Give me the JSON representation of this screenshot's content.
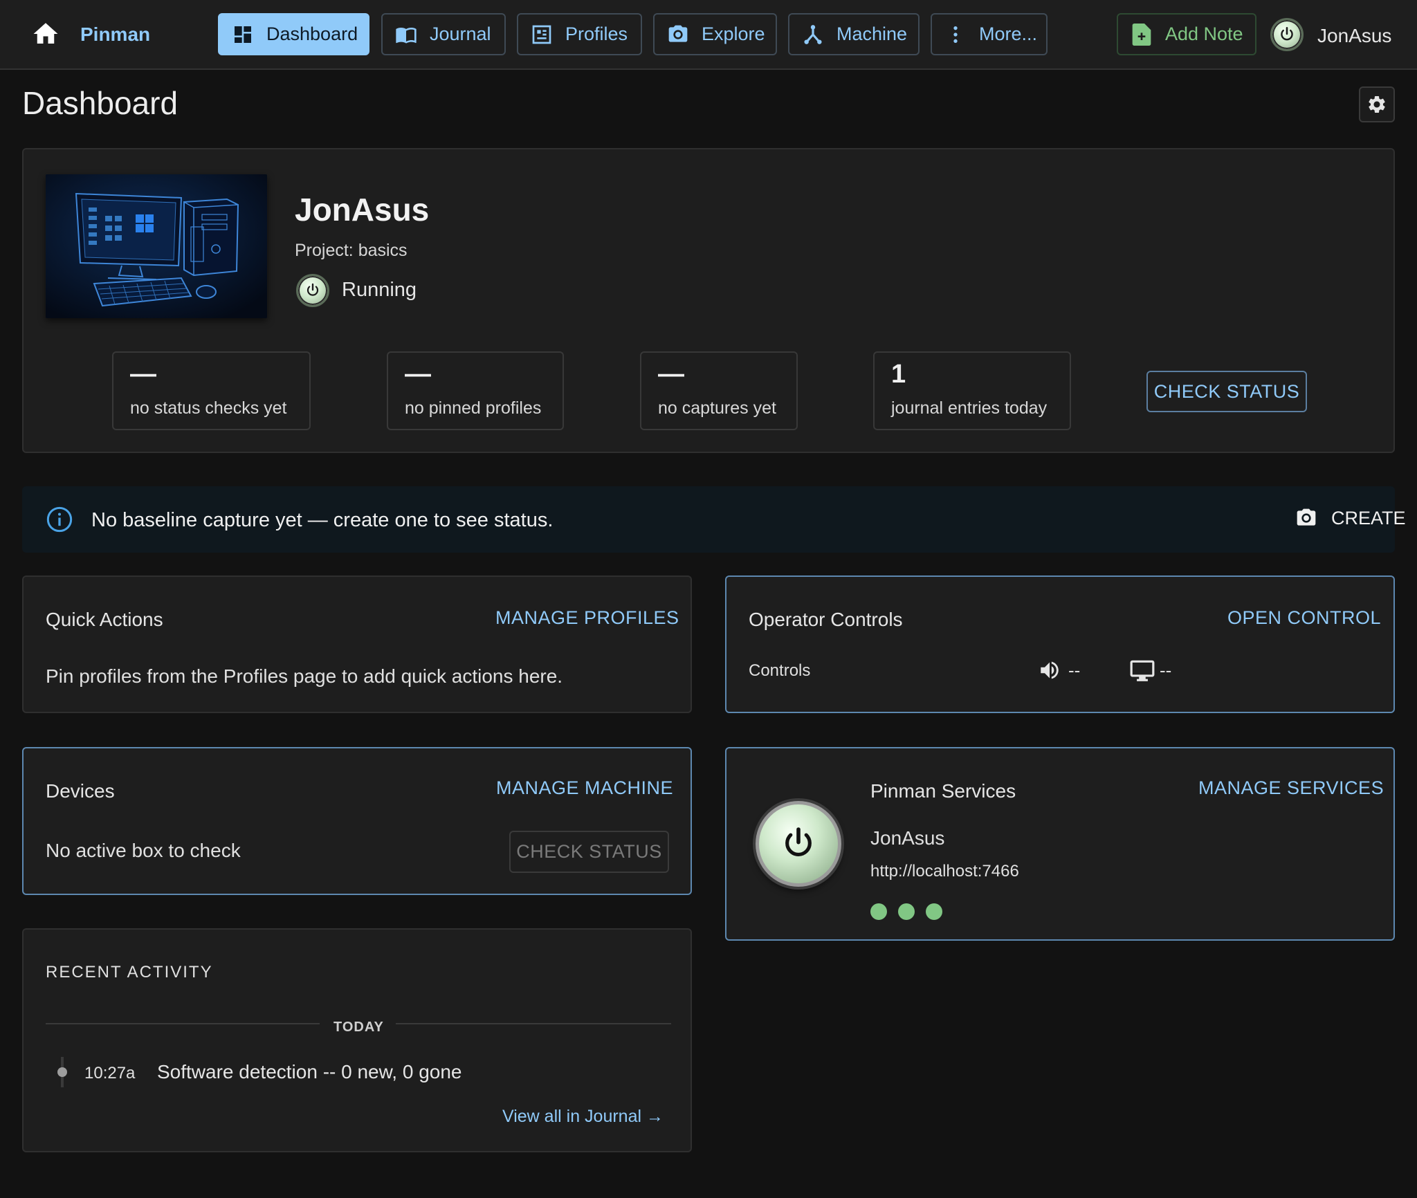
{
  "nav": {
    "brand": "Pinman",
    "tabs": [
      {
        "label": "Dashboard",
        "icon": "dashboard-icon",
        "active": true
      },
      {
        "label": "Journal",
        "icon": "book-icon",
        "active": false
      },
      {
        "label": "Profiles",
        "icon": "profiles-icon",
        "active": false
      },
      {
        "label": "Explore",
        "icon": "camera-icon",
        "active": false
      },
      {
        "label": "Machine",
        "icon": "network-icon",
        "active": false
      },
      {
        "label": "More...",
        "icon": "more-vertical-icon",
        "active": false
      }
    ],
    "add_note": "Add Note",
    "user": "JonAsus"
  },
  "page": {
    "title": "Dashboard"
  },
  "machine": {
    "name": "JonAsus",
    "project": "Project: basics",
    "status": "Running",
    "stats": [
      {
        "value": "—",
        "label": "no status checks yet"
      },
      {
        "value": "—",
        "label": "no pinned profiles"
      },
      {
        "value": "—",
        "label": "no captures yet"
      },
      {
        "value": "1",
        "label": "journal entries today"
      }
    ],
    "check_status": "CHECK STATUS"
  },
  "alert": {
    "text": "No baseline capture yet — create one to see status.",
    "action": "CREATE"
  },
  "quick_actions": {
    "title": "Quick Actions",
    "link": "MANAGE PROFILES",
    "body": "Pin profiles from the Profiles page to add quick actions here."
  },
  "operator": {
    "title": "Operator Controls",
    "link": "OPEN CONTROL",
    "label": "Controls",
    "volume_value": "--",
    "display_value": "--"
  },
  "devices": {
    "title": "Devices",
    "link": "MANAGE MACHINE",
    "body": "No active box to check",
    "button": "CHECK STATUS"
  },
  "services": {
    "title": "Pinman Services",
    "link": "MANAGE SERVICES",
    "name": "JonAsus",
    "url": "http://localhost:7466",
    "dot_color": "#81c784"
  },
  "activity": {
    "title": "RECENT ACTIVITY",
    "group": "TODAY",
    "items": [
      {
        "time": "10:27a",
        "text": "Software detection -- 0 new, 0 gone"
      }
    ],
    "view_all": "View all in Journal →"
  },
  "colors": {
    "accent": "#90caf9",
    "success": "#81c784",
    "background": "#121212",
    "surface": "#1e1e1e"
  }
}
